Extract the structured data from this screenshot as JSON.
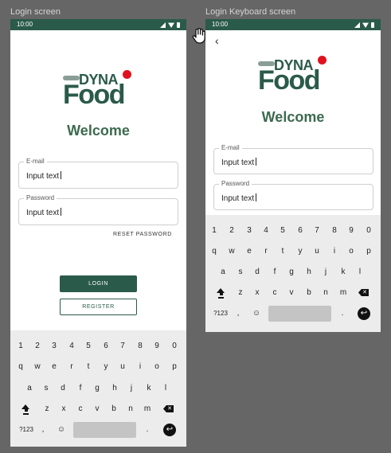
{
  "screens": [
    {
      "frame_title": "Login screen",
      "status": {
        "time": "10:00"
      },
      "logo": {
        "line1": "DYNA",
        "line2": "Food"
      },
      "welcome": "Welcome",
      "email": {
        "label": "E-mail",
        "value": "Input text"
      },
      "password": {
        "label": "Password",
        "value": "Input text"
      },
      "reset_label": "RESET PASSWORD",
      "login_label": "LOGIN",
      "register_label": "REGISTER"
    },
    {
      "frame_title": "Login Keyboard screen",
      "status": {
        "time": "10:00"
      },
      "back_icon": "back-arrow-icon",
      "logo": {
        "line1": "DYNA",
        "line2": "Food"
      },
      "welcome": "Welcome",
      "email": {
        "label": "E-mail",
        "value": "Input text"
      },
      "password": {
        "label": "Password",
        "value": "Input text"
      }
    }
  ],
  "keyboard": {
    "row1": [
      "1",
      "2",
      "3",
      "4",
      "5",
      "6",
      "7",
      "8",
      "9",
      "0"
    ],
    "row2": [
      "q",
      "w",
      "e",
      "r",
      "t",
      "y",
      "u",
      "i",
      "o",
      "p"
    ],
    "row3": [
      "a",
      "s",
      "d",
      "f",
      "g",
      "h",
      "j",
      "k",
      "l"
    ],
    "row4": [
      "z",
      "x",
      "c",
      "v",
      "b",
      "n",
      "m"
    ],
    "symbols_label": "?123",
    "comma": ",",
    "emoji": "☺",
    "period": ".",
    "enter_glyph": "↩",
    "shift_icon": "shift-icon",
    "delete_icon": "backspace-icon"
  },
  "colors": {
    "brand_green": "#2a5a4a",
    "brand_red": "#e0121e",
    "welcome_green": "#3c6a4e",
    "background": "#666666",
    "keyboard_bg": "#ececec"
  },
  "cursor_icon": "hand-pointer-icon"
}
